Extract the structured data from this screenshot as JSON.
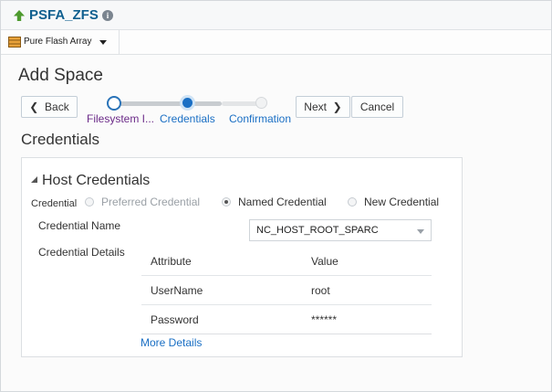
{
  "header": {
    "title": "PSFA_ZFS",
    "up_icon": "up-arrow-icon",
    "info_icon": "info-icon",
    "info_glyph": "i"
  },
  "target_menu": {
    "label": "Pure Flash Array",
    "icon": "storage-array-icon"
  },
  "wizard": {
    "title": "Add Space",
    "back_label": "Back",
    "next_label": "Next",
    "cancel_label": "Cancel",
    "steps": [
      {
        "label": "Filesystem I...",
        "state": "visited"
      },
      {
        "label": "Credentials",
        "state": "current"
      },
      {
        "label": "Confirmation",
        "state": "not-visited"
      }
    ]
  },
  "section_title": "Credentials",
  "host_credentials": {
    "header": "Host Credentials",
    "credential_label": "Credential",
    "options": [
      {
        "label": "Preferred Credential",
        "selected": false,
        "disabled": true
      },
      {
        "label": "Named Credential",
        "selected": true,
        "disabled": false
      },
      {
        "label": "New Credential",
        "selected": false,
        "disabled": false
      }
    ],
    "credential_name_label": "Credential Name",
    "credential_name_value": "NC_HOST_ROOT_SPARC",
    "credential_details_label": "Credential Details",
    "table": {
      "columns": [
        "Attribute",
        "Value"
      ],
      "rows": [
        [
          "UserName",
          "root"
        ],
        [
          "Password",
          "******"
        ]
      ]
    },
    "more_details_label": "More Details"
  },
  "colors": {
    "accent": "#1a6fc4",
    "title_blue": "#0f5f8f",
    "visited_purple": "#6b2a88",
    "up_arrow_green": "#4e9a2f"
  }
}
